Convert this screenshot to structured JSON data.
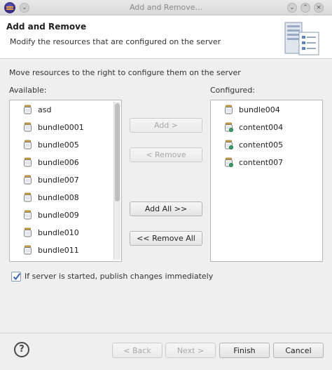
{
  "window": {
    "title": "Add and Remove..."
  },
  "banner": {
    "title": "Add and Remove",
    "description": "Modify the resources that are configured on the server"
  },
  "instructions": "Move resources to the right to configure them on the server",
  "available": {
    "label": "Available:",
    "items": [
      {
        "label": "asd",
        "icon": "bundle-jar-icon"
      },
      {
        "label": "bundle0001",
        "icon": "bundle-jar-icon"
      },
      {
        "label": "bundle005",
        "icon": "bundle-jar-icon"
      },
      {
        "label": "bundle006",
        "icon": "bundle-jar-icon"
      },
      {
        "label": "bundle007",
        "icon": "bundle-jar-icon"
      },
      {
        "label": "bundle008",
        "icon": "bundle-jar-icon"
      },
      {
        "label": "bundle009",
        "icon": "bundle-jar-icon"
      },
      {
        "label": "bundle010",
        "icon": "bundle-jar-icon"
      },
      {
        "label": "bundle011",
        "icon": "bundle-jar-icon"
      }
    ]
  },
  "configured": {
    "label": "Configured:",
    "items": [
      {
        "label": "bundle004",
        "icon": "bundle-jar-icon"
      },
      {
        "label": "content004",
        "icon": "content-jar-icon"
      },
      {
        "label": "content005",
        "icon": "content-jar-icon"
      },
      {
        "label": "content007",
        "icon": "content-jar-icon"
      }
    ]
  },
  "buttons": {
    "add": "Add >",
    "remove": "< Remove",
    "add_all": "Add All >>",
    "remove_all": "<< Remove All"
  },
  "publish_checkbox": {
    "label": "If server is started, publish changes immediately",
    "checked": true
  },
  "footer": {
    "back": "< Back",
    "next": "Next >",
    "finish": "Finish",
    "cancel": "Cancel"
  },
  "colors": {
    "accent": "#4a7bc0",
    "disabled_text": "#a8a8a8"
  }
}
